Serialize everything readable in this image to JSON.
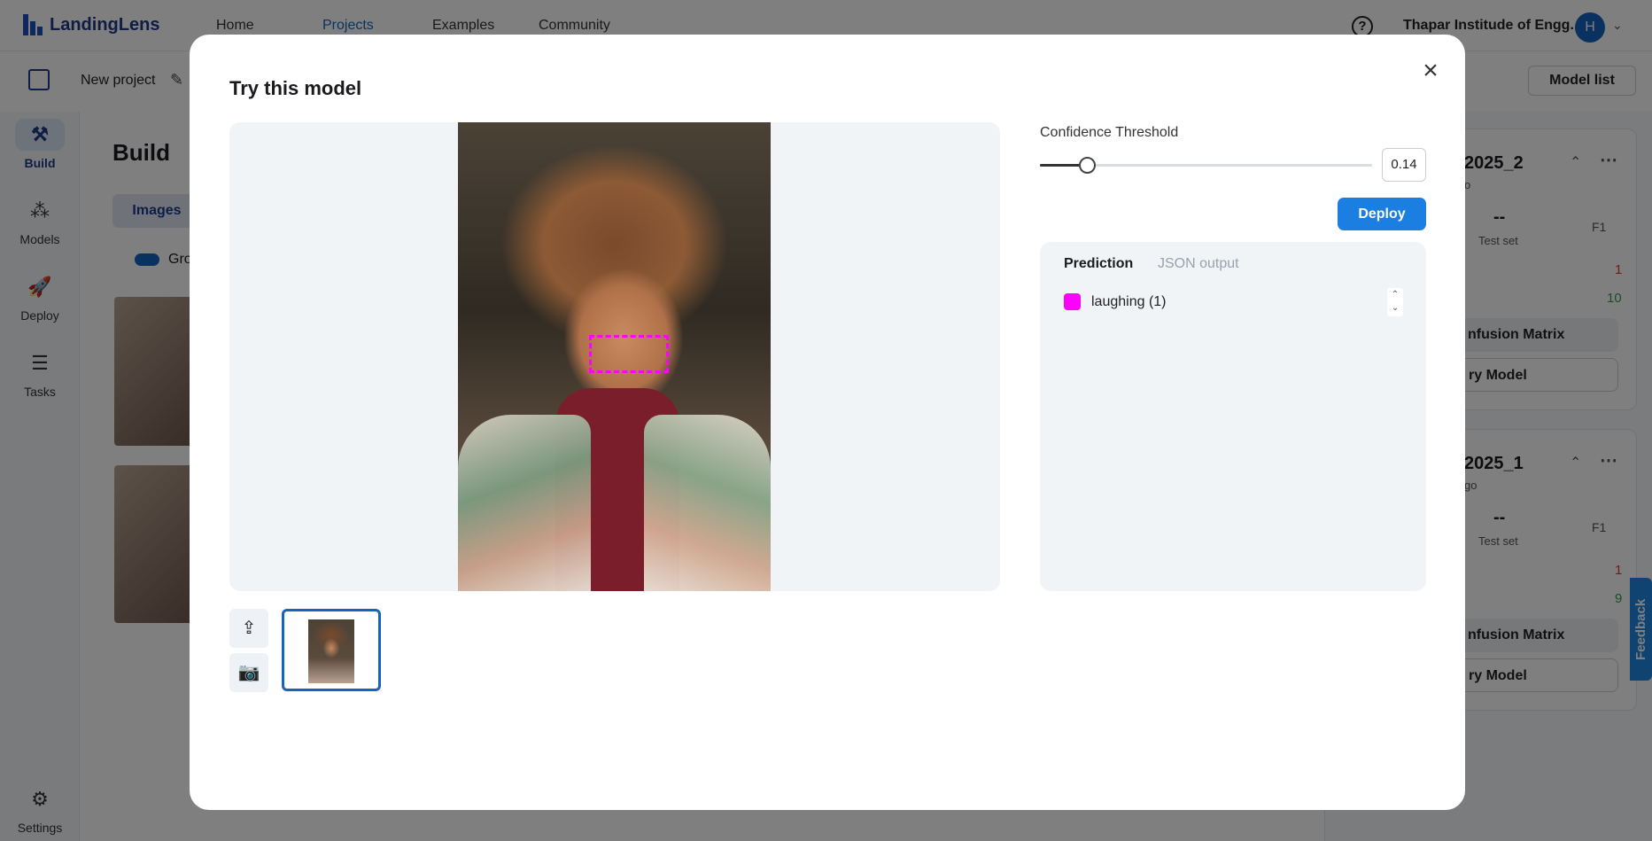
{
  "app": {
    "brand": "LandingLens",
    "nav": [
      "Home",
      "Projects",
      "Examples",
      "Community"
    ],
    "help_glyph": "?",
    "org_name": "Thapar Institude of Engg.",
    "avatar_initial": "H",
    "project_name": "New project",
    "model_list_label": "Model list",
    "sidebar": [
      {
        "label": "Build",
        "icon": "build-icon"
      },
      {
        "label": "Models",
        "icon": "models-icon"
      },
      {
        "label": "Deploy",
        "icon": "deploy-icon"
      },
      {
        "label": "Tasks",
        "icon": "tasks-icon"
      },
      {
        "label": "Settings",
        "icon": "settings-icon"
      }
    ],
    "build_title": "Build",
    "images_tab": "Images",
    "group_toggle_label": "Gro",
    "model_cards": [
      {
        "title": "2025_2",
        "sub": "o",
        "dash": "--",
        "set_label": "Test set",
        "f1": "F1",
        "red_num": "1",
        "green_num": "10",
        "btn1": "nfusion Matrix",
        "btn2": "ry Model"
      },
      {
        "title": "2025_1",
        "sub": "go",
        "dash": "--",
        "set_label": "Test set",
        "f1": "F1",
        "red_num": "1",
        "green_num": "9",
        "btn1": "nfusion Matrix",
        "btn2": "ry Model"
      }
    ],
    "feedback_label": "Feedback"
  },
  "modal": {
    "title": "Try this model",
    "confidence_label": "Confidence Threshold",
    "confidence_value": "0.14",
    "confidence_fraction": 0.14,
    "deploy_label": "Deploy",
    "tabs": {
      "prediction": "Prediction",
      "json": "JSON output"
    },
    "predictions": [
      {
        "label": "laughing (1)",
        "color": "#ff00ff"
      }
    ]
  },
  "colors": {
    "accent": "#1a7fe0",
    "prediction_box": "#ff00ff"
  }
}
